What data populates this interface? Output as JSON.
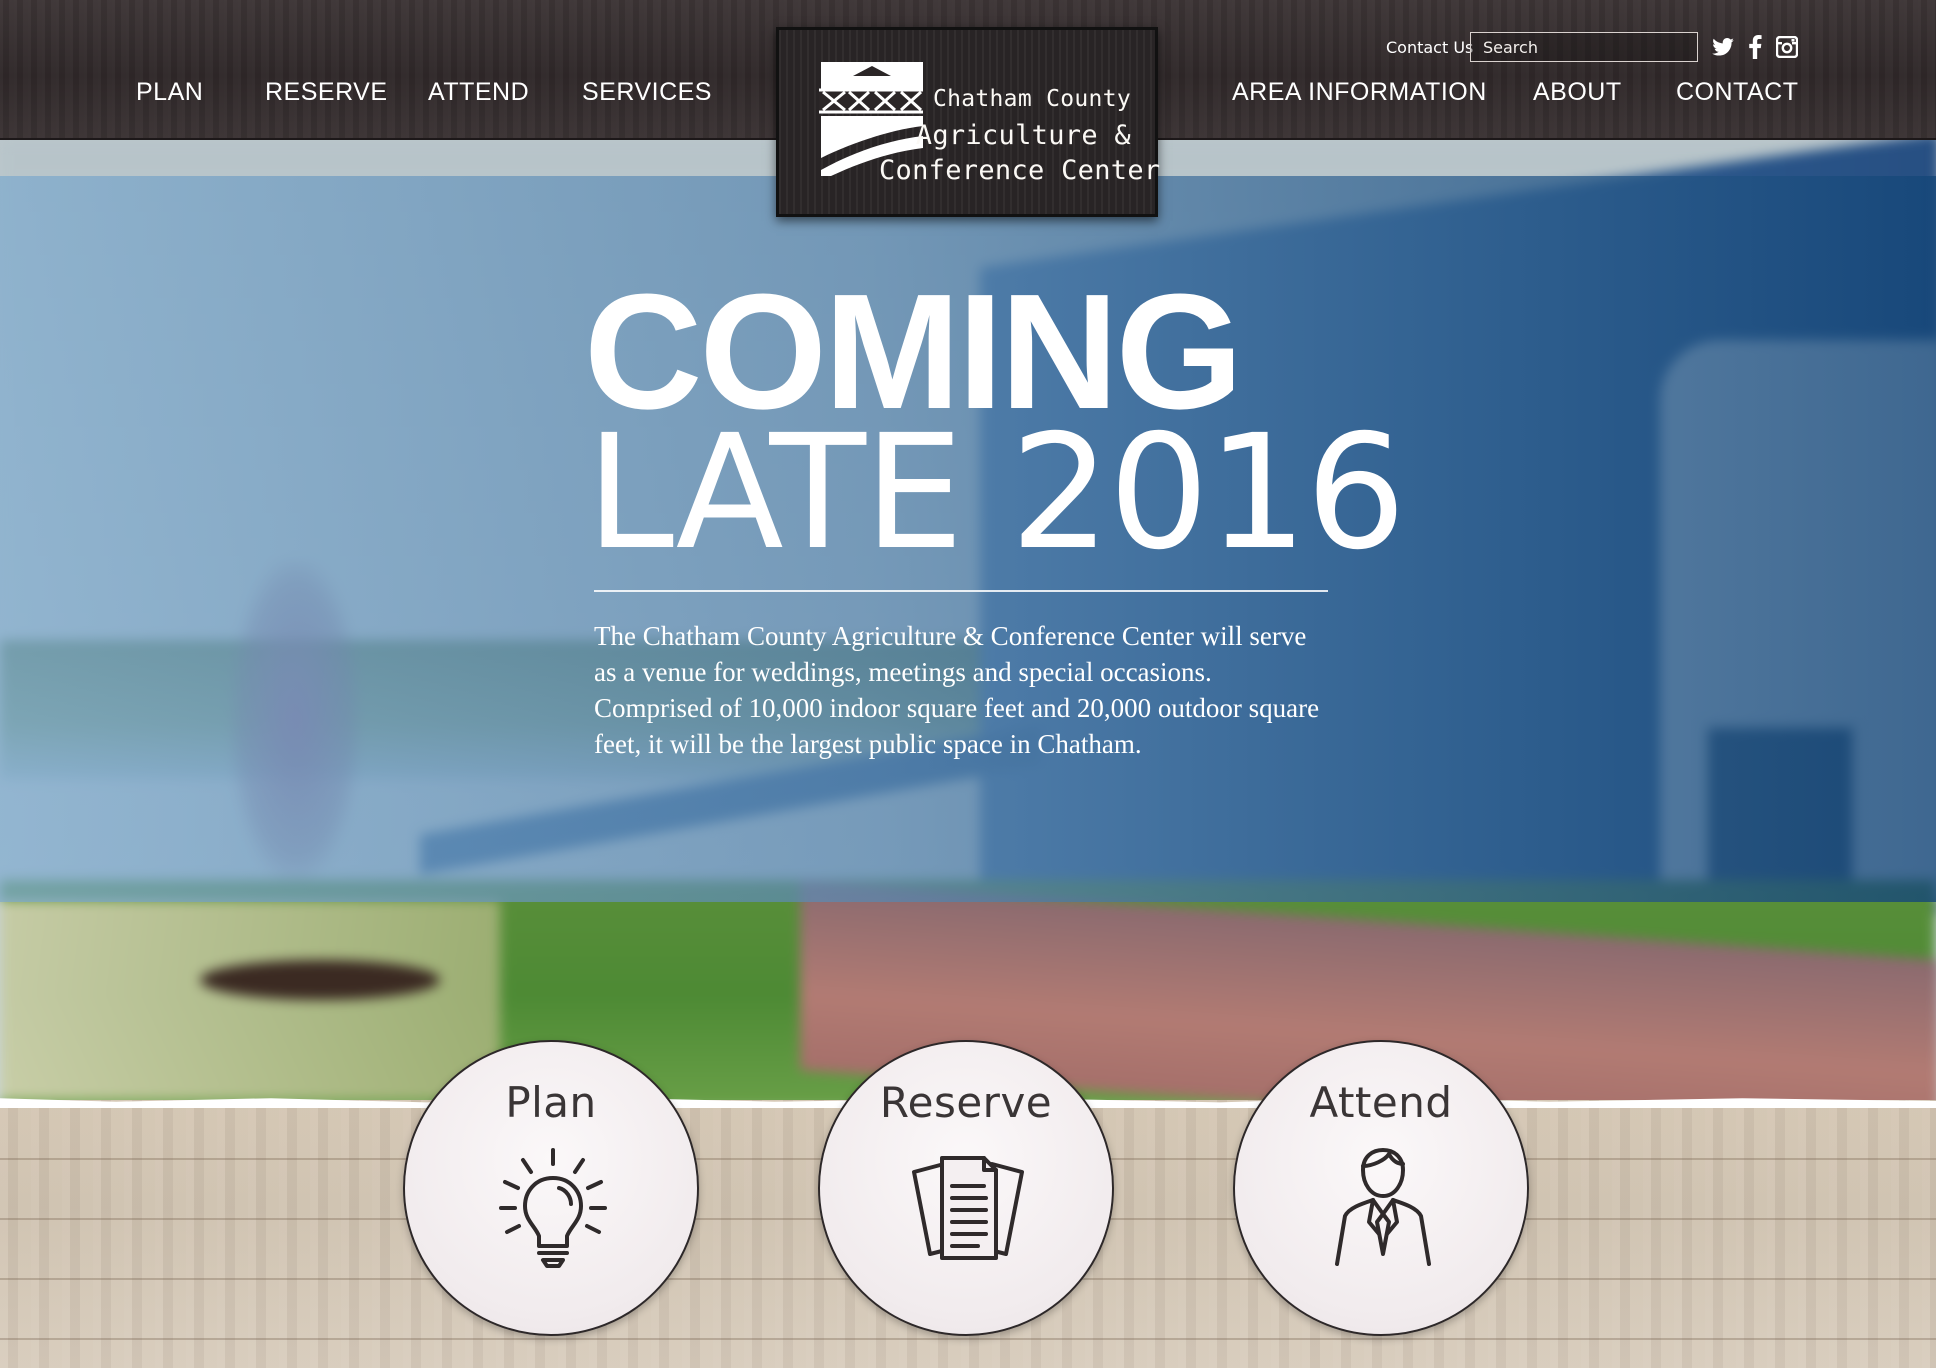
{
  "header": {
    "utility_link": "Contact Us",
    "search_placeholder": "Search",
    "nav_left": [
      "PLAN",
      "RESERVE",
      "ATTEND",
      "SERVICES"
    ],
    "nav_right": [
      "AREA INFORMATION",
      "ABOUT",
      "CONTACT"
    ],
    "social_icons": [
      "twitter-icon",
      "facebook-icon",
      "instagram-icon"
    ]
  },
  "logo": {
    "line1": "Chatham County",
    "line2": "Agriculture &",
    "line3": "Conference Center"
  },
  "hero": {
    "headline_1": "COMING",
    "headline_2": "LATE 2016",
    "description": "The Chatham County Agriculture & Conference Center will serve as a venue for weddings, meetings and special occasions. Comprised of 10,000 indoor square feet and 20,000 outdoor square feet, it will be the largest public space in Chatham."
  },
  "features": [
    {
      "label": "Plan",
      "icon": "lightbulb-icon"
    },
    {
      "label": "Reserve",
      "icon": "documents-icon"
    },
    {
      "label": "Attend",
      "icon": "person-icon"
    }
  ],
  "colors": {
    "header_bg": "#2f2829",
    "hero_overlay": "#5a87af",
    "text_light": "#ffffff",
    "circle_bg": "#f1ebed",
    "wood": "#d4c6b3"
  }
}
